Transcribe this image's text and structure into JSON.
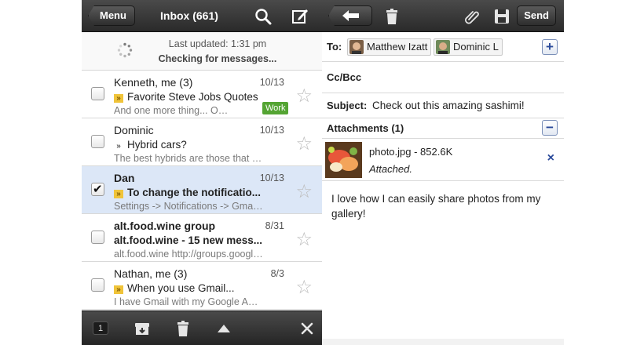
{
  "inbox": {
    "menu_label": "Menu",
    "title": "Inbox (661)",
    "status": {
      "updated": "Last updated: 1:31 pm",
      "checking": "Checking for messages..."
    },
    "messages": [
      {
        "sender": "Kenneth, me (3)",
        "date": "10/13",
        "subject": "Favorite Steve Jobs Quotes",
        "snippet": "And one more thing... On Th...",
        "label": "Work",
        "unread": false,
        "selected": false,
        "checked": false,
        "important": true
      },
      {
        "sender": "Dominic",
        "date": "10/13",
        "subject": "Hybrid cars?",
        "snippet": "The best hybrids are those that dri...",
        "label": "",
        "unread": false,
        "selected": false,
        "checked": false,
        "important": false
      },
      {
        "sender": "Dan",
        "date": "10/13",
        "subject": "To change the notificatio...",
        "snippet": "Settings -> Notifications -> Gmail l...",
        "label": "",
        "unread": true,
        "selected": true,
        "checked": true,
        "important": true
      },
      {
        "sender": "alt.food.wine group",
        "date": "8/31",
        "subject": "alt.food.wine - 15 new mess...",
        "snippet": "alt.food.wine http://groups.google.c...",
        "label": "",
        "unread": true,
        "selected": false,
        "checked": false,
        "important": false
      },
      {
        "sender": "Nathan, me (3)",
        "date": "8/3",
        "subject": "When you use Gmail...",
        "snippet": "I have Gmail with my Google App...",
        "label": "",
        "unread": false,
        "selected": false,
        "checked": false,
        "important": true
      }
    ],
    "selected_count": "1"
  },
  "compose": {
    "send_label": "Send",
    "to_label": "To:",
    "recipients": [
      "Matthew Izatt",
      "Dominic L"
    ],
    "add_recipient": "+",
    "cc_label": "Cc/Bcc",
    "subject_label": "Subject:",
    "subject_value": "Check out this amazing sashimi!",
    "attachments_label": "Attachments (1)",
    "collapse": "−",
    "attachment": {
      "name": "photo.jpg - 852.6K",
      "status": "Attached.",
      "remove": "×"
    },
    "body": "I love how I can easily share photos from my gallery!"
  },
  "glyphs": {
    "important_marker": "»",
    "star": "☆",
    "close": "✕"
  },
  "colors": {
    "toolbar": "#3a3a3a",
    "selected_row": "#dce7f7",
    "work_label": "#54a433",
    "important": "#f0c43a",
    "link_blue": "#2a4a9a"
  }
}
